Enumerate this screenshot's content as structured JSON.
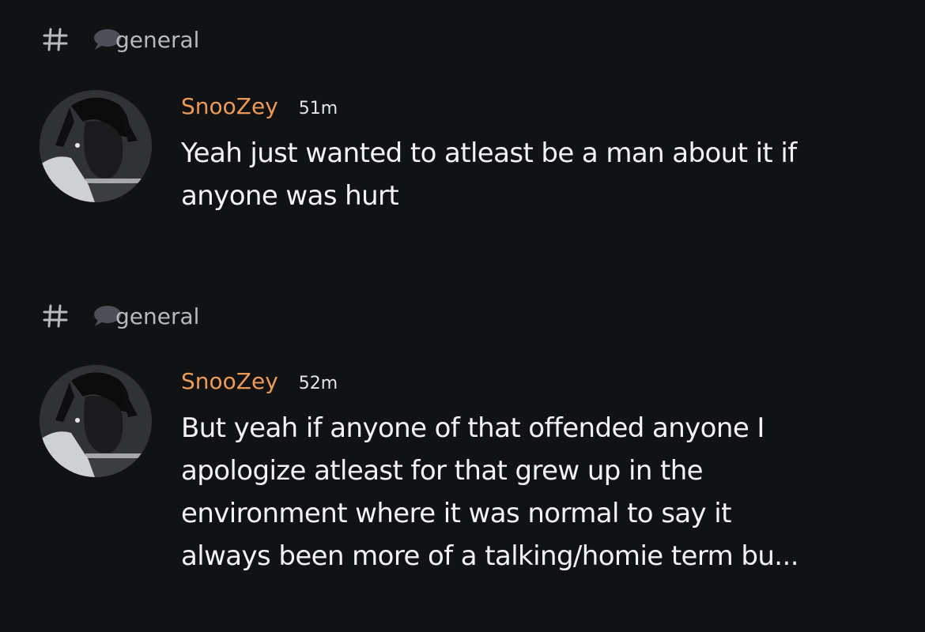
{
  "results": [
    {
      "channel": "general",
      "channel_icon": "hash-icon",
      "channel_emoji": "speech-bubble-icon",
      "author": "SnooZey",
      "time": "51m",
      "text": "Yeah just wanted to atleast be a man about it if\nanyone was hurt"
    },
    {
      "channel": "general",
      "channel_icon": "hash-icon",
      "channel_emoji": "speech-bubble-icon",
      "author": "SnooZey",
      "time": "52m",
      "text": "But yeah if anyone of that offended anyone I\napologize atleast for that grew up in the\nenvironment where it was normal to say it\nalways been more of a talking/homie term bu..."
    }
  ],
  "colors": {
    "background": "#111214",
    "username": "#eb9a58",
    "channel_text": "#b5bac1",
    "message_text": "#f2f3f5"
  }
}
